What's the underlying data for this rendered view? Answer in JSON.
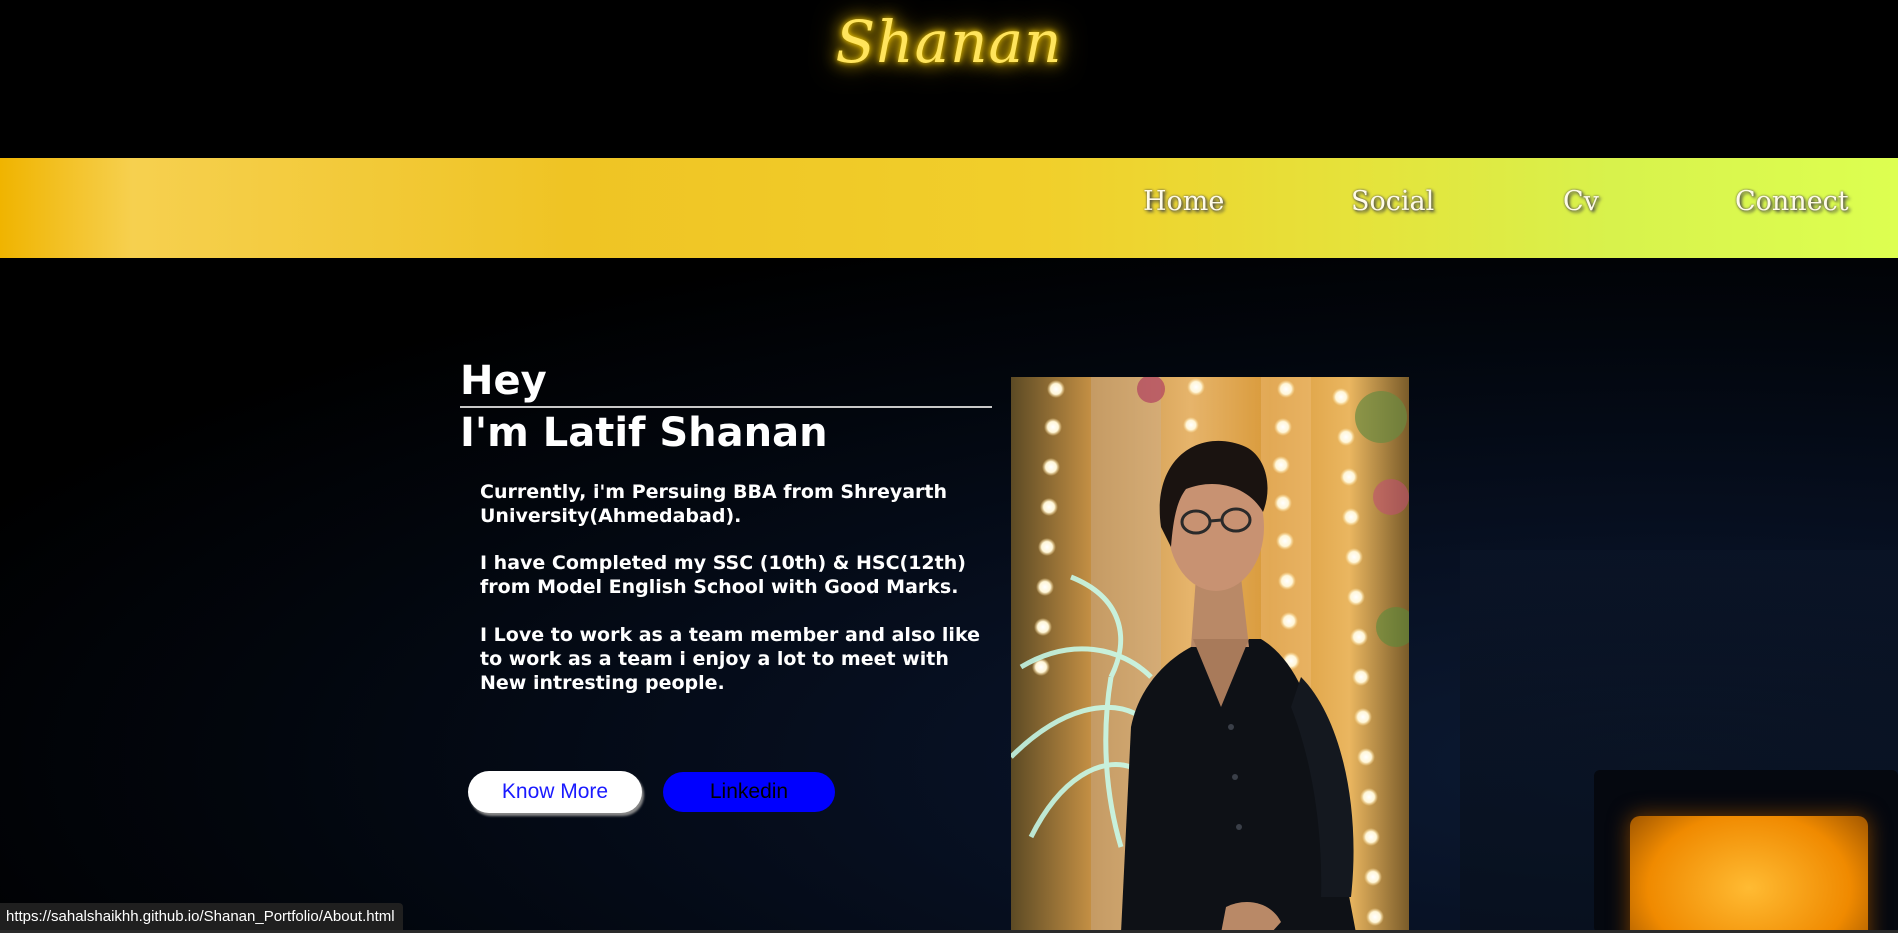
{
  "header": {
    "logo_text": "Shanan"
  },
  "nav": {
    "items": [
      {
        "label": "Home"
      },
      {
        "label": "Social"
      },
      {
        "label": "Cv"
      },
      {
        "label": "Connect"
      }
    ]
  },
  "hero": {
    "greeting": "Hey",
    "name": "I'm Latif Shanan",
    "paragraphs": [
      "Currently, i'm Persuing BBA from Shreyarth University(Ahmedabad).",
      "I have Completed my SSC (10th) & HSC(12th) from Model English School with Good Marks.",
      "I Love to work as a team member and also like to work as a team i enjoy a lot to meet with New intresting people."
    ],
    "buttons": {
      "know_more": "Know More",
      "linkedin": "Linkedin"
    }
  },
  "status": {
    "hover_url": "https://sahalshaikhh.github.io/Shanan_Portfolio/About.html"
  },
  "colors": {
    "logo_glow": "#ffe45c",
    "navbar_start": "#f0b400",
    "navbar_end": "#ddff50",
    "linkedin_button": "#0000ff",
    "know_more_text": "#1a1aff"
  },
  "icons": {
    "profile_photo": "person-photo"
  }
}
